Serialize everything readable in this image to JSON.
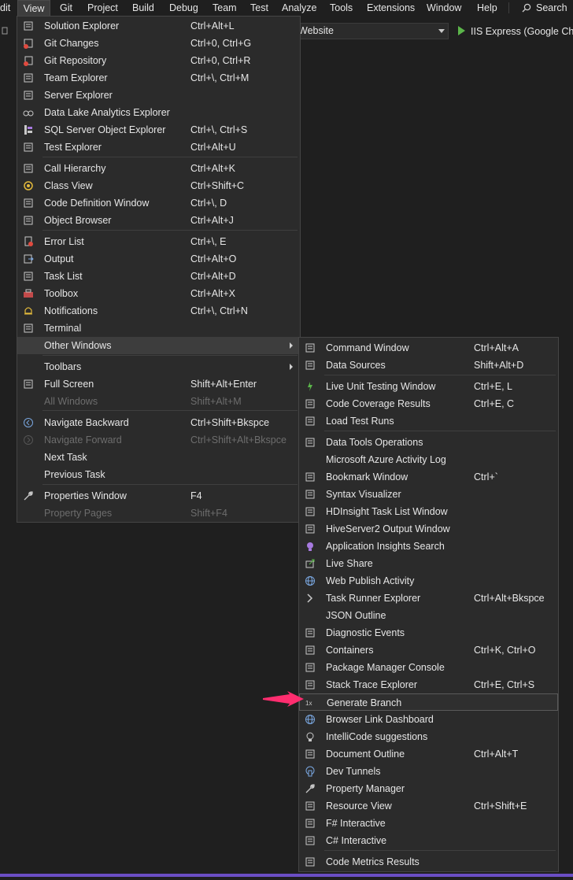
{
  "menubar": {
    "items": [
      "dit",
      "View",
      "Git",
      "Project",
      "Build",
      "Debug",
      "Team",
      "Test",
      "Analyze",
      "Tools",
      "Extensions",
      "Window",
      "Help"
    ],
    "search": "Search"
  },
  "toolbar": {
    "startup_project": "Website",
    "run_label": "IIS Express (Google Chro"
  },
  "view_menu": {
    "items": [
      {
        "label": "Solution Explorer",
        "shortcut": "Ctrl+Alt+L",
        "icon": "solution-explorer-icon"
      },
      {
        "label": "Git Changes",
        "shortcut": "Ctrl+0, Ctrl+G",
        "icon": "git-changes-icon"
      },
      {
        "label": "Git Repository",
        "shortcut": "Ctrl+0, Ctrl+R",
        "icon": "git-repository-icon"
      },
      {
        "label": "Team Explorer",
        "shortcut": "Ctrl+\\, Ctrl+M",
        "icon": "team-explorer-icon"
      },
      {
        "label": "Server Explorer",
        "shortcut": "",
        "icon": "server-explorer-icon"
      },
      {
        "label": "Data Lake Analytics Explorer",
        "shortcut": "",
        "icon": "data-lake-icon"
      },
      {
        "label": "SQL Server Object Explorer",
        "shortcut": "Ctrl+\\, Ctrl+S",
        "icon": "sql-server-icon"
      },
      {
        "label": "Test Explorer",
        "shortcut": "Ctrl+Alt+U",
        "icon": "test-explorer-icon"
      },
      {
        "label": "Call Hierarchy",
        "shortcut": "Ctrl+Alt+K",
        "icon": "call-hierarchy-icon"
      },
      {
        "label": "Class View",
        "shortcut": "Ctrl+Shift+C",
        "icon": "class-view-icon"
      },
      {
        "label": "Code Definition Window",
        "shortcut": "Ctrl+\\, D",
        "icon": "code-definition-icon"
      },
      {
        "label": "Object Browser",
        "shortcut": "Ctrl+Alt+J",
        "icon": "object-browser-icon"
      },
      {
        "label": "Error List",
        "shortcut": "Ctrl+\\, E",
        "icon": "error-list-icon"
      },
      {
        "label": "Output",
        "shortcut": "Ctrl+Alt+O",
        "icon": "output-icon"
      },
      {
        "label": "Task List",
        "shortcut": "Ctrl+Alt+D",
        "icon": "task-list-icon"
      },
      {
        "label": "Toolbox",
        "shortcut": "Ctrl+Alt+X",
        "icon": "toolbox-icon"
      },
      {
        "label": "Notifications",
        "shortcut": "Ctrl+\\, Ctrl+N",
        "icon": "bell-icon"
      },
      {
        "label": "Terminal",
        "shortcut": "",
        "icon": "terminal-icon"
      },
      {
        "label": "Other Windows",
        "shortcut": "",
        "icon": ""
      },
      {
        "label": "Toolbars",
        "shortcut": "",
        "icon": ""
      },
      {
        "label": "Full Screen",
        "shortcut": "Shift+Alt+Enter",
        "icon": "full-screen-icon"
      },
      {
        "label": "All Windows",
        "shortcut": "Shift+Alt+M",
        "icon": ""
      },
      {
        "label": "Navigate Backward",
        "shortcut": "Ctrl+Shift+Bkspce",
        "icon": "navigate-backward-icon"
      },
      {
        "label": "Navigate Forward",
        "shortcut": "Ctrl+Shift+Alt+Bkspce",
        "icon": "navigate-forward-icon"
      },
      {
        "label": "Next Task",
        "shortcut": "",
        "icon": ""
      },
      {
        "label": "Previous Task",
        "shortcut": "",
        "icon": ""
      },
      {
        "label": "Properties Window",
        "shortcut": "F4",
        "icon": "wrench-icon"
      },
      {
        "label": "Property Pages",
        "shortcut": "Shift+F4",
        "icon": ""
      }
    ]
  },
  "other_windows_menu": {
    "items": [
      {
        "label": "Command Window",
        "shortcut": "Ctrl+Alt+A",
        "icon": "command-window-icon"
      },
      {
        "label": "Data Sources",
        "shortcut": "Shift+Alt+D",
        "icon": "data-sources-icon"
      },
      {
        "label": "Live Unit Testing Window",
        "shortcut": "Ctrl+E, L",
        "icon": "live-unit-testing-icon"
      },
      {
        "label": "Code Coverage Results",
        "shortcut": "Ctrl+E, C",
        "icon": "code-coverage-icon"
      },
      {
        "label": "Load Test Runs",
        "shortcut": "",
        "icon": "load-test-icon"
      },
      {
        "label": "Data Tools Operations",
        "shortcut": "",
        "icon": "data-tools-icon"
      },
      {
        "label": "Microsoft Azure Activity Log",
        "shortcut": "",
        "icon": ""
      },
      {
        "label": "Bookmark Window",
        "shortcut": "Ctrl+`",
        "icon": "bookmark-icon"
      },
      {
        "label": "Syntax Visualizer",
        "shortcut": "",
        "icon": "syntax-visualizer-icon"
      },
      {
        "label": "HDInsight Task List Window",
        "shortcut": "",
        "icon": "hdinsight-icon"
      },
      {
        "label": "HiveServer2 Output Window",
        "shortcut": "",
        "icon": "hiveserver-icon"
      },
      {
        "label": "Application Insights Search",
        "shortcut": "",
        "icon": "app-insights-icon"
      },
      {
        "label": "Live Share",
        "shortcut": "",
        "icon": "live-share-icon"
      },
      {
        "label": "Web Publish Activity",
        "shortcut": "",
        "icon": "globe-icon"
      },
      {
        "label": "Task Runner Explorer",
        "shortcut": "Ctrl+Alt+Bkspce",
        "icon": "chevron-right-icon"
      },
      {
        "label": "JSON Outline",
        "shortcut": "",
        "icon": ""
      },
      {
        "label": "Diagnostic Events",
        "shortcut": "",
        "icon": "diagnostic-events-icon"
      },
      {
        "label": "Containers",
        "shortcut": "Ctrl+K, Ctrl+O",
        "icon": "containers-icon"
      },
      {
        "label": "Package Manager Console",
        "shortcut": "",
        "icon": "package-manager-icon"
      },
      {
        "label": "Stack Trace Explorer",
        "shortcut": "Ctrl+E, Ctrl+S",
        "icon": "stack-trace-icon"
      },
      {
        "label": "Generate Branch",
        "shortcut": "",
        "icon": "generate-branch-icon"
      },
      {
        "label": "Browser Link Dashboard",
        "shortcut": "",
        "icon": "browser-link-icon"
      },
      {
        "label": "IntelliCode suggestions",
        "shortcut": "",
        "icon": "intellicode-icon"
      },
      {
        "label": "Document Outline",
        "shortcut": "Ctrl+Alt+T",
        "icon": "document-outline-icon"
      },
      {
        "label": "Dev Tunnels",
        "shortcut": "",
        "icon": "dev-tunnels-icon"
      },
      {
        "label": "Property Manager",
        "shortcut": "",
        "icon": "wrench-icon"
      },
      {
        "label": "Resource View",
        "shortcut": "Ctrl+Shift+E",
        "icon": "resource-view-icon"
      },
      {
        "label": "F# Interactive",
        "shortcut": "",
        "icon": "fsharp-interactive-icon"
      },
      {
        "label": "C# Interactive",
        "shortcut": "",
        "icon": "csharp-interactive-icon"
      },
      {
        "label": "Code Metrics Results",
        "shortcut": "",
        "icon": "code-metrics-icon"
      }
    ]
  },
  "colors": {
    "accent": "#6b4ec4",
    "pointer": "#ff2d6f",
    "run_green": "#5bb54a"
  }
}
